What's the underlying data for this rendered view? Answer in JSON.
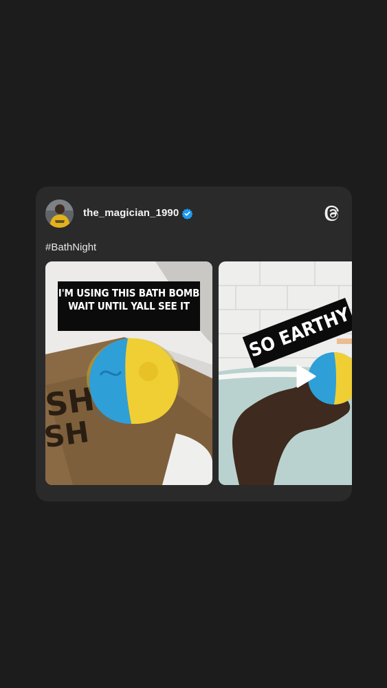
{
  "post": {
    "username": "the_magician_1990",
    "verified": true,
    "caption": "#BathNight",
    "app_icon": "threads-logo-icon"
  },
  "media": [
    {
      "kind": "image",
      "overlay_text": "I'M USING THIS BATH BOMB WAIT UNTIL YALL SEE IT"
    },
    {
      "kind": "video",
      "overlay_text": "SO EARTHY",
      "play_icon": "play-icon"
    }
  ],
  "colors": {
    "background": "#1c1c1c",
    "card": "#2a2a2a",
    "verified_badge": "#1d9bf0",
    "text": "#f5f5f5"
  }
}
